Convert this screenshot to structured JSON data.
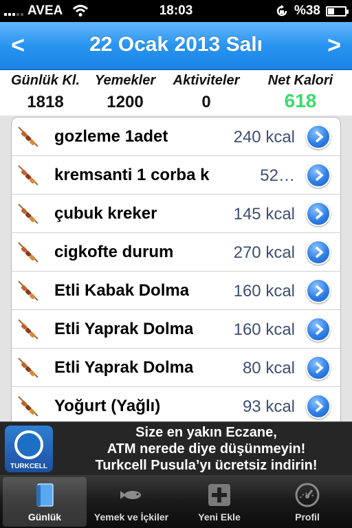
{
  "status_bar": {
    "carrier": "AVEA",
    "time": "18:03",
    "battery": "%38",
    "battery_level": 0.38
  },
  "header": {
    "date": "22 Ocak 2013 Salı",
    "prev": "<",
    "next": ">"
  },
  "summary": {
    "daily_label": "Günlük Kl.",
    "daily_value": "1818",
    "food_label": "Yemekler",
    "food_value": "1200",
    "activity_label": "Aktiviteler",
    "activity_value": "0",
    "net_label": "Net Kalori",
    "net_value": "618",
    "net_color": "#3adb6b"
  },
  "items": [
    {
      "name": "gozleme 1adet",
      "kcal": "240 kcal"
    },
    {
      "name": "kremsanti 1 corba k",
      "kcal": "52…"
    },
    {
      "name": "çubuk kreker",
      "kcal": "145 kcal"
    },
    {
      "name": "cigkofte durum",
      "kcal": "270 kcal"
    },
    {
      "name": "Etli Kabak Dolma",
      "kcal": "160 kcal"
    },
    {
      "name": "Etli Yaprak Dolma",
      "kcal": "160 kcal"
    },
    {
      "name": "Etli Yaprak Dolma",
      "kcal": "80 kcal"
    },
    {
      "name": "Yoğurt (Yağlı)",
      "kcal": "93 kcal"
    }
  ],
  "ad": {
    "brand": "TURKCELL",
    "line1": "Size en yakın Eczane,",
    "line2": "ATM nerede diye düşünmeyin!",
    "line3": "Turkcell Pusula’yı ücretsiz indirin!"
  },
  "tabs": [
    {
      "label": "Günlük",
      "icon": "book-icon"
    },
    {
      "label": "Yemek ve İçkiler",
      "icon": "fish-icon"
    },
    {
      "label": "Yeni Ekle",
      "icon": "plus-icon"
    },
    {
      "label": "Profil",
      "icon": "gauge-icon"
    }
  ],
  "colors": {
    "header_blue": "#2894f0",
    "kcal_text": "#3d4e73",
    "disclosure_blue": "#2e7fe6"
  }
}
